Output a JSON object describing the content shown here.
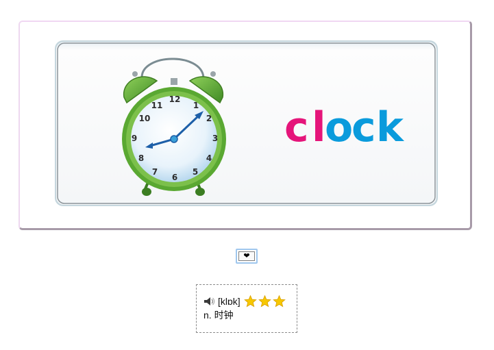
{
  "flashcard": {
    "word": "clock",
    "image_alt": "alarm clock",
    "clock_numbers": [
      "12",
      "1",
      "2",
      "3",
      "4",
      "5",
      "6",
      "7",
      "8",
      "9",
      "10",
      "11"
    ]
  },
  "favorite_button": {
    "icon": "heart-icon",
    "glyph": "❤"
  },
  "word_info": {
    "speaker_icon": "speaker-icon",
    "phonetic": "[klɒk]",
    "star_count": 3,
    "definition": "n. 时钟"
  },
  "colors": {
    "word_pink": "#e5157a",
    "word_blue": "#0a9bdc",
    "clock_green": "#5aa832",
    "clock_hand_blue": "#1d5fa8",
    "star_yellow": "#f7c800"
  }
}
